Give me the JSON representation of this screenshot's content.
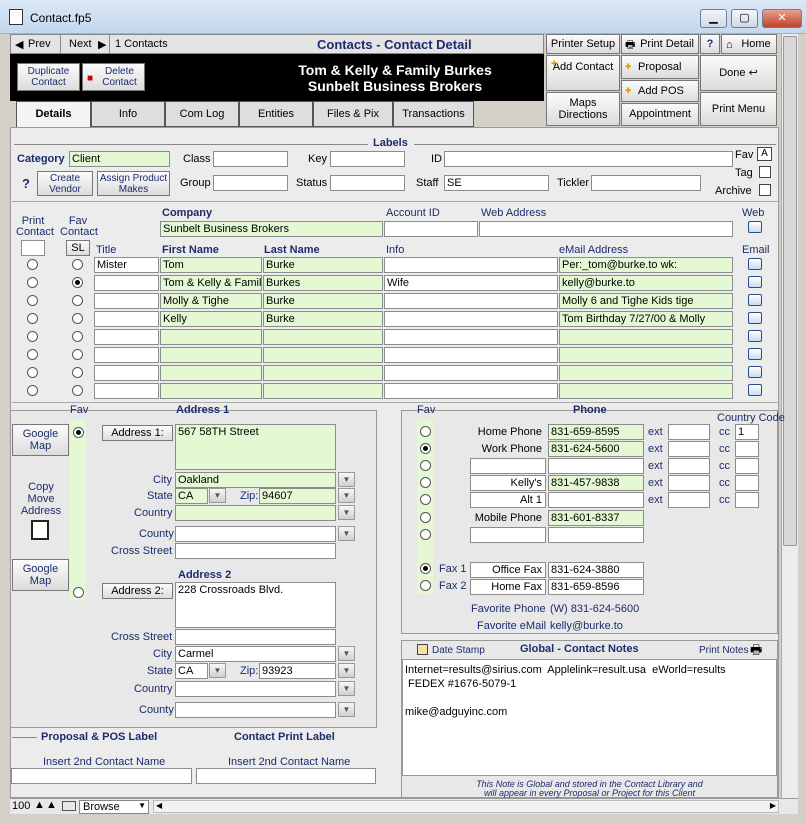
{
  "window": {
    "title": "Contact.fp5",
    "min": "▁",
    "max": "▢",
    "close": "✕"
  },
  "nav": {
    "prev": "Prev",
    "next": "Next",
    "count": "1 Contacts",
    "title": "Contacts - Contact Detail"
  },
  "top_buttons": {
    "printer_setup": "Printer Setup",
    "print_detail": "Print Detail",
    "help": "?",
    "home": "Home",
    "add_contact": "Add Contact",
    "proposal": "Proposal",
    "add_pos": "Add POS",
    "done": "Done",
    "maps": "Maps Directions",
    "appointment": "Appointment",
    "print_menu": "Print Menu"
  },
  "header": {
    "dup": "Duplicate Contact",
    "del": "Delete Contact",
    "name": "Tom & Kelly & Family Burkes",
    "company": "Sunbelt Business Brokers"
  },
  "tabs": [
    "Details",
    "Info",
    "Com Log",
    "Entities",
    "Files & Pix",
    "Transactions"
  ],
  "labels_section": {
    "title": "Labels",
    "category_label": "Category",
    "category": "Client",
    "class_label": "Class",
    "class": "",
    "key_label": "Key",
    "key": "",
    "id_label": "ID",
    "id": "",
    "group_label": "Group",
    "group": "",
    "status_label": "Status",
    "status": "",
    "staff_label": "Staff",
    "staff": "SE",
    "tickler_label": "Tickler",
    "tickler": "",
    "fav_label": "Fav",
    "tag_label": "Tag",
    "archive_label": "Archive",
    "help": "?",
    "create_vendor": "Create Vendor",
    "assign_product": "Assign Product Makes"
  },
  "company": {
    "print_contact": "Print Contact",
    "fav_contact": "Fav Contact",
    "sl": "SL",
    "label": "Company",
    "value": "Sunbelt Business Brokers",
    "account_label": "Account ID",
    "web_label": "Web Address",
    "web_col": "Web",
    "email_col": "Email"
  },
  "contacts": {
    "headers": [
      "Title",
      "First Name",
      "Last Name",
      "Info",
      "eMail Address"
    ],
    "rows": [
      {
        "title": "Mister",
        "first": "Tom",
        "last": "Burke",
        "info": "",
        "email": "Per:_tom@burke.to      wk:",
        "fav": false
      },
      {
        "title": "",
        "first": "Tom & Kelly & Family",
        "last": "Burkes",
        "info": "Wife",
        "email": "kelly@burke.to",
        "fav": true
      },
      {
        "title": "",
        "first": "Molly & Tighe",
        "last": "Burke",
        "info": "",
        "email": "Molly 6 and Tighe   Kids  tige",
        "fav": false
      },
      {
        "title": "",
        "first": "Kelly",
        "last": "Burke",
        "info": "",
        "email": "Tom Birthday 7/27/00 & Molly",
        "fav": false
      },
      {
        "title": "",
        "first": "",
        "last": "",
        "info": "",
        "email": "",
        "fav": false
      },
      {
        "title": "",
        "first": "",
        "last": "",
        "info": "",
        "email": "",
        "fav": false
      },
      {
        "title": "",
        "first": "",
        "last": "",
        "info": "",
        "email": "",
        "fav": false
      },
      {
        "title": "",
        "first": "",
        "last": "",
        "info": "",
        "email": "",
        "fav": false
      }
    ]
  },
  "address": {
    "fav": "Fav",
    "title1": "Address 1",
    "google_map": "Google Map",
    "addr1_btn": "Address 1:",
    "addr1": "567 58TH Street",
    "city_label": "City",
    "city1": "Oakland",
    "state_label": "State",
    "state1": "CA",
    "zip_label": "Zip:",
    "zip1": "94607",
    "country_label": "Country",
    "country1": "",
    "county_label": "County",
    "county1": "",
    "cross_label": "Cross Street",
    "cross1": "",
    "copy": "Copy Move Address",
    "title2": "Address 2",
    "addr2_btn": "Address 2:",
    "addr2": "228 Crossroads Blvd.",
    "cross2": "",
    "city2": "Carmel",
    "state2": "CA",
    "zip2": "93923",
    "country2": "",
    "county2": ""
  },
  "phone": {
    "fav": "Fav",
    "title": "Phone",
    "country_code": "Country Code",
    "ext": "ext",
    "cc": "cc",
    "rows": [
      {
        "label": "Home Phone",
        "value": "831-659-8595",
        "cc": "1",
        "fav": false
      },
      {
        "label": "Work Phone",
        "value": "831-624-5600",
        "cc": "",
        "fav": true
      },
      {
        "label": "",
        "value": "",
        "cc": "",
        "fav": false
      },
      {
        "label": "Kelly's",
        "value": "831-457-9838",
        "cc": "",
        "fav": false
      },
      {
        "label": "Alt 1",
        "value": "",
        "cc": "",
        "fav": false
      },
      {
        "label": "Mobile Phone",
        "value": "831-601-8337",
        "cc": "",
        "fav": false
      },
      {
        "label": "",
        "value": "",
        "cc": "",
        "fav": false
      }
    ],
    "fax1_label": "Fax 1",
    "fax1_name": "Office Fax",
    "fax1": "831-624-3880",
    "fax2_label": "Fax 2",
    "fax2_name": "Home Fax",
    "fax2": "831-659-8596",
    "fav_phone_label": "Favorite Phone",
    "fav_phone": "(W) 831-624-5600",
    "fav_email_label": "Favorite eMail",
    "fav_email": "kelly@burke.to"
  },
  "notes": {
    "date_stamp": "Date Stamp",
    "title": "Global - Contact Notes",
    "print_notes": "Print Notes",
    "lines": [
      "Internet=results@sirius.com  Applelink=result.usa  eWorld=results",
      " FEDEX #1676-5079-1",
      "",
      "mike@adguyinc.com"
    ],
    "footer1": "This Note is Global and stored in the Contact Library and",
    "footer2": "will appear in every Proposal or Project for this Client"
  },
  "bottom": {
    "proposal_label": "Proposal & POS Label",
    "print_label": "Contact Print Label",
    "insert1": "Insert 2nd Contact Name",
    "insert2": "Insert 2nd Contact Name"
  },
  "status": {
    "zoom": "100",
    "mode": "Browse"
  }
}
